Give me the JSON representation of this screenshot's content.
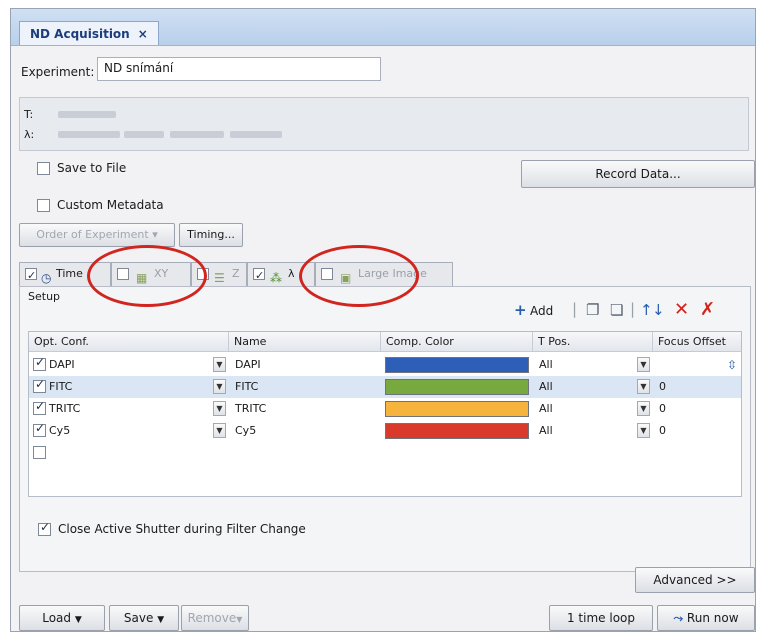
{
  "window": {
    "tab_title": "ND Acquisition",
    "tab_close": "×"
  },
  "experiment": {
    "label": "Experiment:",
    "value": "ND snímání"
  },
  "summary": {
    "t_label": "T:",
    "lambda_label": "λ:"
  },
  "options": {
    "save_to_file": "Save to File",
    "custom_metadata": "Custom Metadata",
    "record_data": "Record Data...",
    "order_of_experiment": "Order of Experiment ▾",
    "timing": "Timing..."
  },
  "tabs": [
    {
      "label": "Time",
      "checked": true
    },
    {
      "label": "XY",
      "checked": false
    },
    {
      "label": "Z",
      "checked": false
    },
    {
      "label": "λ",
      "checked": true
    },
    {
      "label": "Large Image",
      "checked": false
    }
  ],
  "setup": {
    "title": "Setup",
    "add": "Add",
    "columns": [
      "Opt. Conf.",
      "Name",
      "Comp. Color",
      "T Pos.",
      "Focus Offset"
    ],
    "rows": [
      {
        "opt": "DAPI",
        "name": "DAPI",
        "color": "#2e5fb8",
        "tpos": "All",
        "focus": ""
      },
      {
        "opt": "FITC",
        "name": "FITC",
        "color": "#78a93f",
        "tpos": "All",
        "focus": "0"
      },
      {
        "opt": "TRITC",
        "name": "TRITC",
        "color": "#f6b43c",
        "tpos": "All",
        "focus": "0"
      },
      {
        "opt": "Cy5",
        "name": "Cy5",
        "color": "#d93a2b",
        "tpos": "All",
        "focus": "0"
      }
    ],
    "close_shutter": "Close Active Shutter during Filter Change",
    "advanced": "Advanced >>"
  },
  "bottom": {
    "load": "Load",
    "save": "Save",
    "remove": "Remove",
    "loop": "1 time loop",
    "run_now": "Run now"
  }
}
